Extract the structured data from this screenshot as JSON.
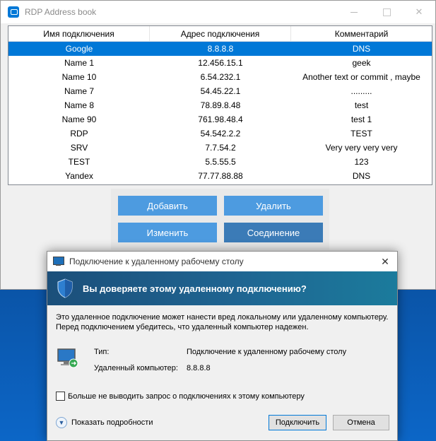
{
  "window": {
    "title": "RDP Address book",
    "app_icon": "rdp-icon",
    "close_glyph": "✕"
  },
  "table": {
    "columns": [
      "Имя подключения",
      "Адрес подключения",
      "Комментарий"
    ],
    "selected_index": 0,
    "rows": [
      [
        "Google",
        "8.8.8.8",
        "DNS"
      ],
      [
        "Name 1",
        "12.456.15.1",
        "geek"
      ],
      [
        "Name 10",
        "6.54.232.1",
        "Another text or commit , maybe"
      ],
      [
        "Name 7",
        "54.45.22.1",
        "........."
      ],
      [
        "Name 8",
        "78.89.8.48",
        "test"
      ],
      [
        "Name 90",
        "761.98.48.4",
        "test 1"
      ],
      [
        "RDP",
        "54.542.2.2",
        "TEST"
      ],
      [
        "SRV",
        "7.7.54.2",
        "Very very very very"
      ],
      [
        "TEST",
        "5.5.55.5",
        "123"
      ],
      [
        "Yandex",
        "77.77.88.88",
        "DNS"
      ]
    ]
  },
  "buttons": {
    "add": "Добавить",
    "delete": "Удалить",
    "edit": "Изменить",
    "connect": "Соединение"
  },
  "dialog": {
    "title": "Подключение к удаленному рабочему столу",
    "close_glyph": "✕",
    "banner": "Вы доверяете этому удаленному подключению?",
    "warning_line1": "Это удаленное подключение может нанести вред локальному или удаленному компьютеру.",
    "warning_line2": "Перед подключением убедитесь, что удаленный компьютер надежен.",
    "type_label": "Тип:",
    "type_value": "Подключение к удаленному рабочему столу",
    "computer_label": "Удаленный компьютер:",
    "computer_value": "8.8.8.8",
    "checkbox_label": "Больше не выводить запрос о подключениях к этому компьютеру",
    "checkbox_checked": false,
    "details_label": "Показать подробности",
    "connect_button": "Подключить",
    "cancel_button": "Отмена"
  },
  "colors": {
    "selection": "#0078d7",
    "button": "#4d9be0",
    "button_active": "#3b7bb7",
    "banner": "#1f6592"
  }
}
